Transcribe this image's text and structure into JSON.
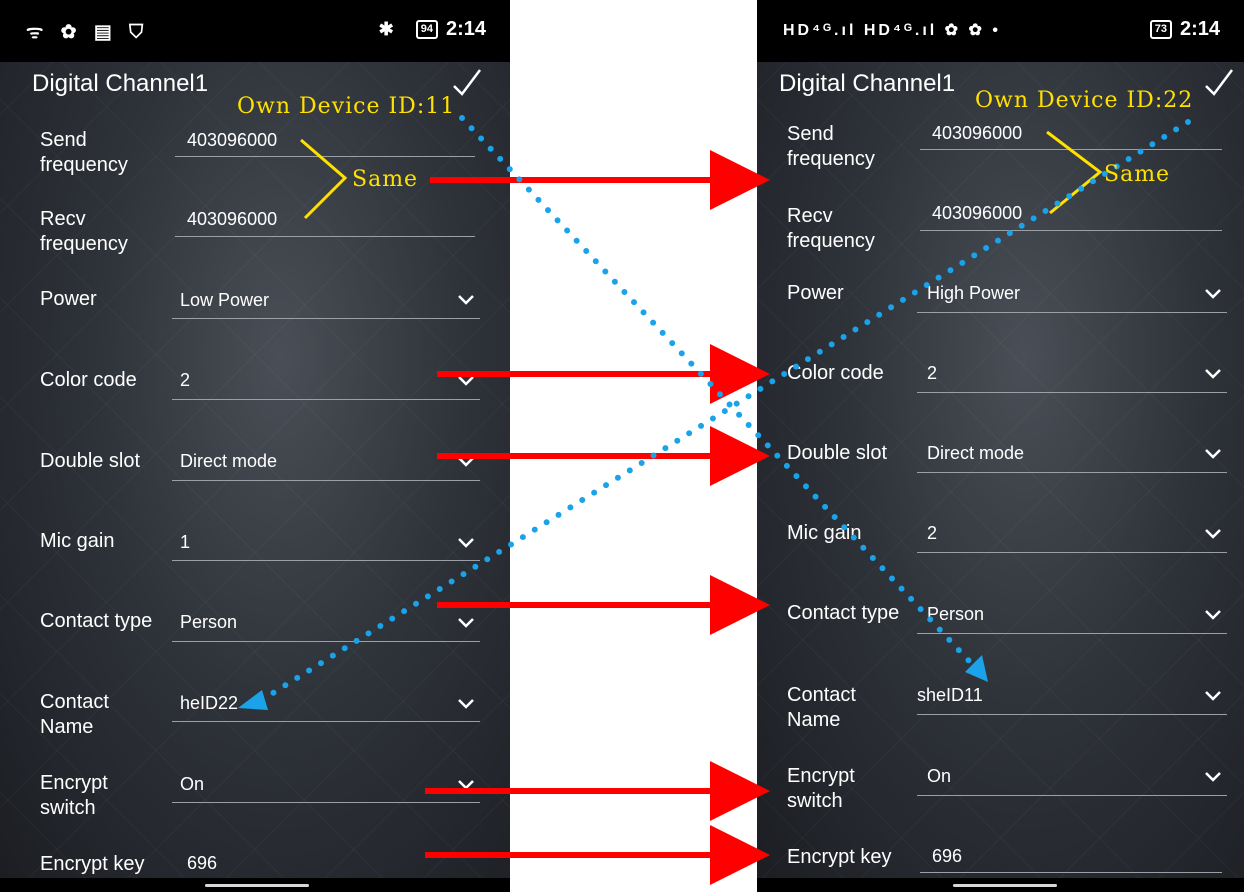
{
  "left": {
    "status": {
      "icons": "ᯤ ✿ ▤ ⛉",
      "bluetooth": "✱",
      "battery": "94",
      "time": "2:14"
    },
    "title": "Digital Channel1",
    "fields": {
      "send_label": "Send frequency",
      "send_value": "403096000",
      "recv_label": "Recv frequency",
      "recv_value": "403096000",
      "power_label": "Power",
      "power_value": "Low Power",
      "color_label": "Color code",
      "color_value": "2",
      "slot_label": "Double slot",
      "slot_value": "Direct mode",
      "mic_label": "Mic gain",
      "mic_value": "1",
      "ctype_label": "Contact type",
      "ctype_value": "Person",
      "cname_label": "Contact Name",
      "cname_value": "heID22",
      "encsw_label": "Encrypt switch",
      "encsw_value": "On",
      "enckey_label": "Encrypt key",
      "enckey_value": "696"
    }
  },
  "right": {
    "status": {
      "icons": "HD⁴ᴳ.ıl HD⁴ᴳ.ıl ✿ ✿ •",
      "battery": "73",
      "time": "2:14"
    },
    "title": "Digital Channel1",
    "fields": {
      "send_label": "Send frequency",
      "send_value": "403096000",
      "recv_label": "Recv frequency",
      "recv_value": "403096000",
      "power_label": "Power",
      "power_value": "High Power",
      "color_label": "Color code",
      "color_value": "2",
      "slot_label": "Double slot",
      "slot_value": "Direct mode",
      "mic_label": "Mic gain",
      "mic_value": "2",
      "ctype_label": "Contact type",
      "ctype_value": "Person",
      "cname_label": "Contact Name",
      "cname_value": "sheID11",
      "encsw_label": "Encrypt switch",
      "encsw_value": "On",
      "enckey_label": "Encrypt key",
      "enckey_value": "696"
    }
  },
  "annotations": {
    "own_id_left": "Own Device ID:11",
    "own_id_right": "Own Device ID:22",
    "same_left": "Same",
    "same_right": "Same"
  },
  "colors": {
    "arrow": "#ff0000",
    "dots": "#1aa3e8",
    "annotation": "#ffe100"
  }
}
